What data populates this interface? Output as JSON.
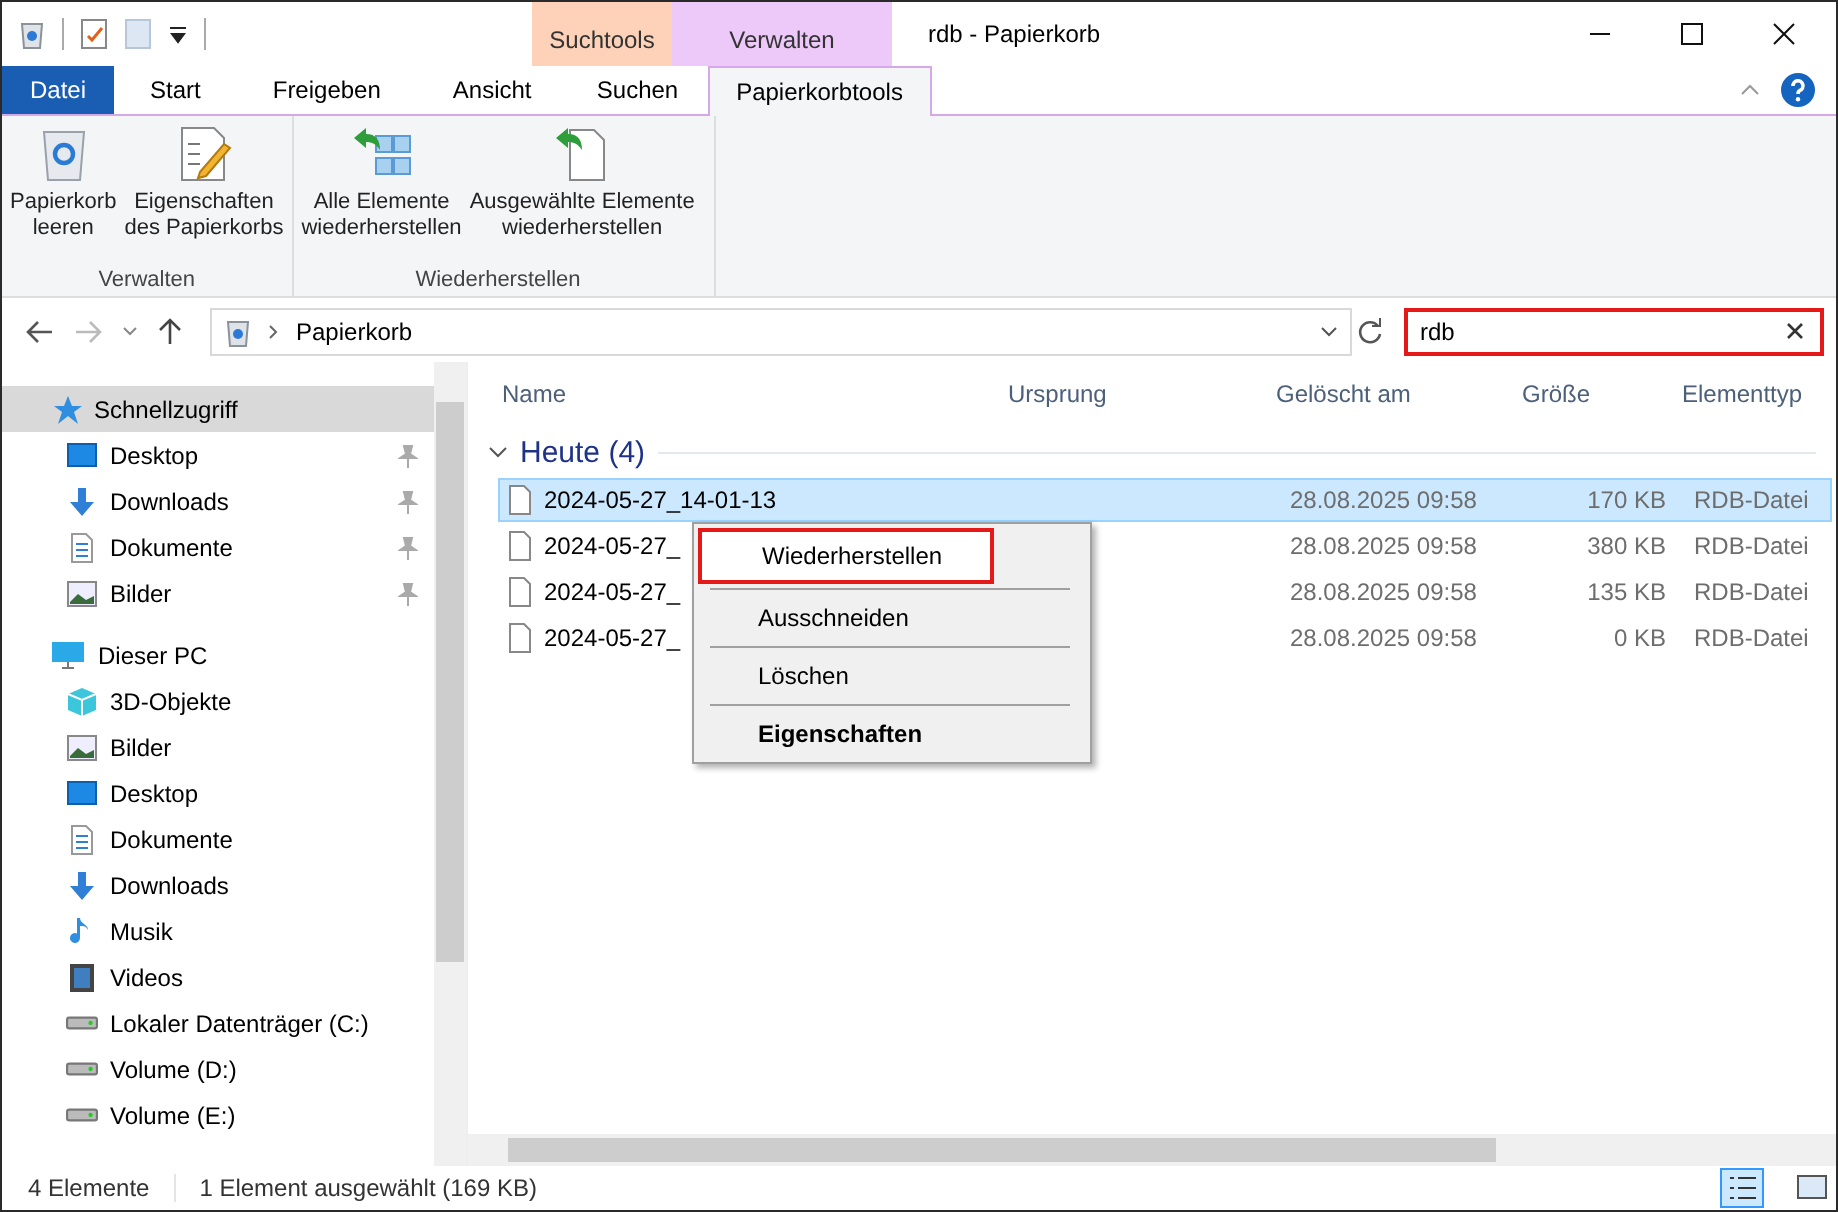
{
  "window": {
    "title": "rdb - Papierkorb"
  },
  "context_tabs": [
    {
      "label": "Suchtools",
      "color": "#fdd2b8"
    },
    {
      "label": "Verwalten",
      "color": "#ecc9f8"
    }
  ],
  "ribbon_tabs": [
    {
      "label": "Datei",
      "kind": "file",
      "selected": false
    },
    {
      "label": "Start",
      "kind": "tab",
      "selected": false
    },
    {
      "label": "Freigeben",
      "kind": "tab",
      "selected": false
    },
    {
      "label": "Ansicht",
      "kind": "tab",
      "selected": false
    },
    {
      "label": "Suchen",
      "kind": "tab",
      "selected": false
    },
    {
      "label": "Papierkorbtools",
      "kind": "tab",
      "selected": true
    }
  ],
  "ribbon_groups": [
    {
      "label": "Verwalten",
      "buttons": [
        {
          "label": "Papierkorb\nleeren",
          "kind": "bin"
        },
        {
          "label": "Eigenschaften\ndes Papierkorbs",
          "kind": "props"
        }
      ]
    },
    {
      "label": "Wiederherstellen",
      "buttons": [
        {
          "label": "Alle Elemente\nwiederherstellen",
          "kind": "restore-all"
        },
        {
          "label": "Ausgewählte Elemente\nwiederherstellen",
          "kind": "restore-sel"
        }
      ]
    }
  ],
  "address": {
    "path": "Papierkorb"
  },
  "search": {
    "value": "rdb"
  },
  "sidebar": {
    "items": [
      {
        "label": "Schnellzugriff",
        "kind": "star",
        "pinned": false,
        "selected": true,
        "top": true
      },
      {
        "label": "Desktop",
        "kind": "desktop",
        "pinned": true,
        "selected": false,
        "top": false
      },
      {
        "label": "Downloads",
        "kind": "download",
        "pinned": true,
        "selected": false,
        "top": false
      },
      {
        "label": "Dokumente",
        "kind": "doc",
        "pinned": true,
        "selected": false,
        "top": false
      },
      {
        "label": "Bilder",
        "kind": "pics",
        "pinned": true,
        "selected": false,
        "top": false
      },
      {
        "label": "Dieser PC",
        "kind": "pc",
        "pinned": false,
        "selected": false,
        "top": true
      },
      {
        "label": "3D-Objekte",
        "kind": "cube",
        "pinned": false,
        "selected": false,
        "top": false
      },
      {
        "label": "Bilder",
        "kind": "pics",
        "pinned": false,
        "selected": false,
        "top": false
      },
      {
        "label": "Desktop",
        "kind": "desktop",
        "pinned": false,
        "selected": false,
        "top": false
      },
      {
        "label": "Dokumente",
        "kind": "doc",
        "pinned": false,
        "selected": false,
        "top": false
      },
      {
        "label": "Downloads",
        "kind": "download",
        "pinned": false,
        "selected": false,
        "top": false
      },
      {
        "label": "Musik",
        "kind": "music",
        "pinned": false,
        "selected": false,
        "top": false
      },
      {
        "label": "Videos",
        "kind": "video",
        "pinned": false,
        "selected": false,
        "top": false
      },
      {
        "label": "Lokaler Datenträger (C:)",
        "kind": "drive",
        "pinned": false,
        "selected": false,
        "top": false
      },
      {
        "label": "Volume (D:)",
        "kind": "drive",
        "pinned": false,
        "selected": false,
        "top": false
      },
      {
        "label": "Volume (E:)",
        "kind": "drive",
        "pinned": false,
        "selected": false,
        "top": false
      }
    ]
  },
  "table": {
    "columns": [
      "Name",
      "Ursprung",
      "Gelöscht am",
      "Größe",
      "Elementtyp"
    ],
    "group": {
      "label": "Heute (4)",
      "expanded": true
    },
    "rows": [
      {
        "name": "2024-05-27_14-01-13",
        "deleted": "28.08.2025 09:58",
        "size": "170 KB",
        "type": "RDB-Datei",
        "selected": true
      },
      {
        "name": "2024-05-27_",
        "deleted": "28.08.2025 09:58",
        "size": "380 KB",
        "type": "RDB-Datei",
        "selected": false
      },
      {
        "name": "2024-05-27_",
        "deleted": "28.08.2025 09:58",
        "size": "135 KB",
        "type": "RDB-Datei",
        "selected": false
      },
      {
        "name": "2024-05-27_",
        "deleted": "28.08.2025 09:58",
        "size": "0 KB",
        "type": "RDB-Datei",
        "selected": false
      }
    ]
  },
  "context_menu": [
    {
      "label": "Wiederherstellen",
      "bold": false,
      "highlighted": true
    },
    {
      "label": "Ausschneiden",
      "bold": false,
      "highlighted": false
    },
    {
      "label": "Löschen",
      "bold": false,
      "highlighted": false
    },
    {
      "label": "Eigenschaften",
      "bold": true,
      "highlighted": false
    }
  ],
  "status_bar": {
    "count": "4 Elemente",
    "selection": "1 Element ausgewählt (169 KB)"
  }
}
